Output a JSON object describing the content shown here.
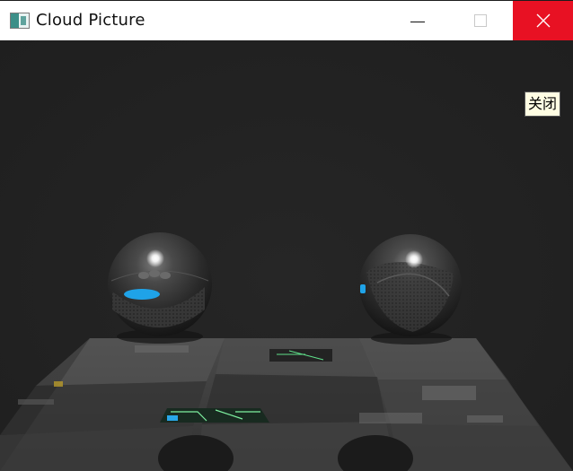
{
  "window": {
    "title": "Cloud Picture",
    "app_icon": "picture-app-icon",
    "controls": {
      "minimize_icon": "minimize-icon",
      "maximize_icon": "maximize-icon",
      "close_icon": "close-icon",
      "close_hover_color": "#e81123"
    }
  },
  "tooltip": {
    "text": "关闭"
  },
  "scene": {
    "background_color": "#222222",
    "objects": [
      "left-robot-sphere",
      "right-robot-sphere",
      "textured-ground-plane"
    ],
    "accent_color": "#1fa3e8"
  }
}
